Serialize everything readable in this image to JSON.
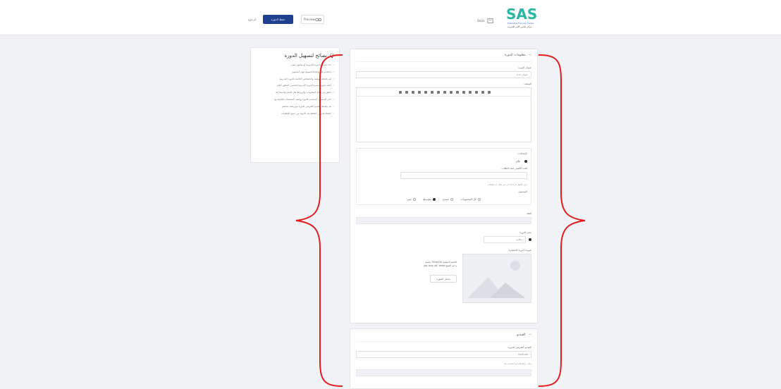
{
  "header": {
    "logo_word": "SAS",
    "logo_en": "Ertibatiat Training Center",
    "logo_ar": "مركز سامي الأمر للتدريب",
    "store_label": "Store",
    "view_label": "Preview",
    "save_label": "حفظ الدورة",
    "back_label": "الرجوع"
  },
  "sidebar": {
    "title": "نصائح لتسهيل الدورة",
    "tips": [
      "حدد عنوان الدورة التدريبية أو محتوى مميز",
      "استخدم لغة واضحة لتسهيل فهم المحتوى",
      "قم بإضافة الوصف والخصائص الخاصة بالدورة التدريبية",
      "أضف صورة مميزة للدورة التدريبية لتحسين المظهر العام",
      "تحقق من صحة المعلومات والروابط قبل النشر والمشاركة",
      "اختر المستوى المناسب للدورة واضف التصنيفات الخاصة بها",
      "قم بإضافة الفيديو التعريفي للدورة مع وصف مختصر",
      "اضغط على زر الحفظ بعد الانتهاء من جميع الخطوات"
    ]
  },
  "main": {
    "section_title": "معلومات الدورة",
    "title_label": "عنوان الدورة",
    "title_placeholder": "عنوان جديد",
    "desc_label": "الوصف",
    "options_label": "الإعدادات",
    "free_label": "عام",
    "count_label": "الحد الأقصى لعدد الطلاب",
    "note": "اترك الحقل فارغا إذا لم يكن هناك حد للطلاب",
    "level_label": "المستوى",
    "levels": [
      "كل المستويات",
      "مبتدئ",
      "متوسط",
      "خبير"
    ],
    "level_selected": 2,
    "category_label": "الفئة",
    "price_label": "سعر الدورة",
    "price_value": "مجاني",
    "image_label": "صورة الدورة المصغرة",
    "image_hint": "الحجم المفضل 700x430 بكسل",
    "image_hint2": "يدعم الصيغ jpg, png, gif, webp",
    "upload_label": "تحميل الصورة"
  },
  "video": {
    "section_title": "الفيديو",
    "label": "الفيديو التعريفي للدورة",
    "value": "YouTube",
    "hint": "مثال: رابط الفيديو المناسب هنا"
  }
}
